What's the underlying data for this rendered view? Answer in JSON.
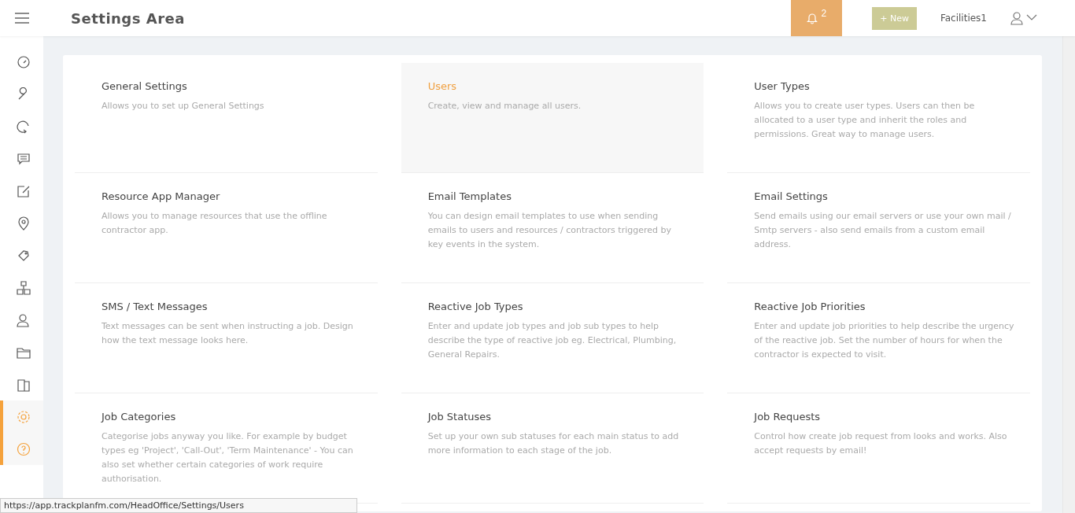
{
  "header": {
    "title": "Settings Area",
    "notifications": "2",
    "new_button": "+ New",
    "account": "Facilities1"
  },
  "sidebar": {
    "items": [
      {
        "selected": false
      },
      {
        "selected": false
      },
      {
        "selected": false
      },
      {
        "selected": false
      },
      {
        "selected": false
      },
      {
        "selected": false
      },
      {
        "selected": false
      },
      {
        "selected": false
      },
      {
        "selected": false
      },
      {
        "selected": false
      },
      {
        "selected": false
      },
      {
        "selected": true
      },
      {
        "selected": true
      }
    ]
  },
  "tiles": [
    {
      "title": "General Settings",
      "description": "Allows you to set up General Settings",
      "selected": false
    },
    {
      "title": "Users",
      "description": "Create, view and manage all users.",
      "selected": true
    },
    {
      "title": "User Types",
      "description": "Allows you to create user types. Users can then be allocated to a user type and inherit the roles and permissions. Great way to manage users.",
      "selected": false
    },
    {
      "title": "Resource App Manager",
      "description": "Allows you to manage resources that use the offline contractor app.",
      "selected": false
    },
    {
      "title": "Email Templates",
      "description": "You can design email templates to use when sending emails to users and resources / contractors triggered by key events in the system.",
      "selected": false
    },
    {
      "title": "Email Settings",
      "description": "Send emails using our email servers or use your own mail / Smtp servers - also send emails from a custom email address.",
      "selected": false
    },
    {
      "title": "SMS / Text Messages",
      "description": "Text messages can be sent when instructing a job. Design how the text message looks here.",
      "selected": false
    },
    {
      "title": "Reactive Job Types",
      "description": "Enter and update job types and job sub types to help describe the type of reactive job eg. Electrical, Plumbing, General Repairs.",
      "selected": false
    },
    {
      "title": "Reactive Job Priorities",
      "description": "Enter and update job priorities to help describe the urgency of the reactive job. Set the number of hours for when the contractor is expected to visit.",
      "selected": false
    },
    {
      "title": "Job Categories",
      "description": "Categorise jobs anyway you like. For example by budget types eg 'Project', 'Call-Out', 'Term Maintenance' - You can also set whether certain categories of work require authorisation.",
      "selected": false
    },
    {
      "title": "Job Statuses",
      "description": "Set up your own sub statuses for each main status to add more information to each stage of the job.",
      "selected": false
    },
    {
      "title": "Job Requests",
      "description": "Control how create job request from looks and works. Also accept requests by email!",
      "selected": false
    }
  ],
  "status_bar": {
    "url": "https://app.trackplanfm.com/HeadOffice/Settings/Users"
  }
}
